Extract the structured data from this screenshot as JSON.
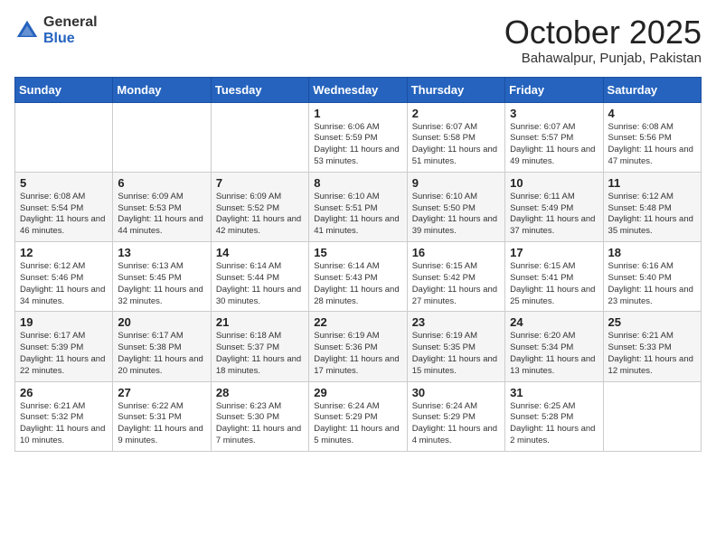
{
  "logo": {
    "general": "General",
    "blue": "Blue"
  },
  "title": "October 2025",
  "location": "Bahawalpur, Punjab, Pakistan",
  "days_of_week": [
    "Sunday",
    "Monday",
    "Tuesday",
    "Wednesday",
    "Thursday",
    "Friday",
    "Saturday"
  ],
  "weeks": [
    [
      {
        "day": "",
        "info": ""
      },
      {
        "day": "",
        "info": ""
      },
      {
        "day": "",
        "info": ""
      },
      {
        "day": "1",
        "info": "Sunrise: 6:06 AM\nSunset: 5:59 PM\nDaylight: 11 hours and 53 minutes."
      },
      {
        "day": "2",
        "info": "Sunrise: 6:07 AM\nSunset: 5:58 PM\nDaylight: 11 hours and 51 minutes."
      },
      {
        "day": "3",
        "info": "Sunrise: 6:07 AM\nSunset: 5:57 PM\nDaylight: 11 hours and 49 minutes."
      },
      {
        "day": "4",
        "info": "Sunrise: 6:08 AM\nSunset: 5:56 PM\nDaylight: 11 hours and 47 minutes."
      }
    ],
    [
      {
        "day": "5",
        "info": "Sunrise: 6:08 AM\nSunset: 5:54 PM\nDaylight: 11 hours and 46 minutes."
      },
      {
        "day": "6",
        "info": "Sunrise: 6:09 AM\nSunset: 5:53 PM\nDaylight: 11 hours and 44 minutes."
      },
      {
        "day": "7",
        "info": "Sunrise: 6:09 AM\nSunset: 5:52 PM\nDaylight: 11 hours and 42 minutes."
      },
      {
        "day": "8",
        "info": "Sunrise: 6:10 AM\nSunset: 5:51 PM\nDaylight: 11 hours and 41 minutes."
      },
      {
        "day": "9",
        "info": "Sunrise: 6:10 AM\nSunset: 5:50 PM\nDaylight: 11 hours and 39 minutes."
      },
      {
        "day": "10",
        "info": "Sunrise: 6:11 AM\nSunset: 5:49 PM\nDaylight: 11 hours and 37 minutes."
      },
      {
        "day": "11",
        "info": "Sunrise: 6:12 AM\nSunset: 5:48 PM\nDaylight: 11 hours and 35 minutes."
      }
    ],
    [
      {
        "day": "12",
        "info": "Sunrise: 6:12 AM\nSunset: 5:46 PM\nDaylight: 11 hours and 34 minutes."
      },
      {
        "day": "13",
        "info": "Sunrise: 6:13 AM\nSunset: 5:45 PM\nDaylight: 11 hours and 32 minutes."
      },
      {
        "day": "14",
        "info": "Sunrise: 6:14 AM\nSunset: 5:44 PM\nDaylight: 11 hours and 30 minutes."
      },
      {
        "day": "15",
        "info": "Sunrise: 6:14 AM\nSunset: 5:43 PM\nDaylight: 11 hours and 28 minutes."
      },
      {
        "day": "16",
        "info": "Sunrise: 6:15 AM\nSunset: 5:42 PM\nDaylight: 11 hours and 27 minutes."
      },
      {
        "day": "17",
        "info": "Sunrise: 6:15 AM\nSunset: 5:41 PM\nDaylight: 11 hours and 25 minutes."
      },
      {
        "day": "18",
        "info": "Sunrise: 6:16 AM\nSunset: 5:40 PM\nDaylight: 11 hours and 23 minutes."
      }
    ],
    [
      {
        "day": "19",
        "info": "Sunrise: 6:17 AM\nSunset: 5:39 PM\nDaylight: 11 hours and 22 minutes."
      },
      {
        "day": "20",
        "info": "Sunrise: 6:17 AM\nSunset: 5:38 PM\nDaylight: 11 hours and 20 minutes."
      },
      {
        "day": "21",
        "info": "Sunrise: 6:18 AM\nSunset: 5:37 PM\nDaylight: 11 hours and 18 minutes."
      },
      {
        "day": "22",
        "info": "Sunrise: 6:19 AM\nSunset: 5:36 PM\nDaylight: 11 hours and 17 minutes."
      },
      {
        "day": "23",
        "info": "Sunrise: 6:19 AM\nSunset: 5:35 PM\nDaylight: 11 hours and 15 minutes."
      },
      {
        "day": "24",
        "info": "Sunrise: 6:20 AM\nSunset: 5:34 PM\nDaylight: 11 hours and 13 minutes."
      },
      {
        "day": "25",
        "info": "Sunrise: 6:21 AM\nSunset: 5:33 PM\nDaylight: 11 hours and 12 minutes."
      }
    ],
    [
      {
        "day": "26",
        "info": "Sunrise: 6:21 AM\nSunset: 5:32 PM\nDaylight: 11 hours and 10 minutes."
      },
      {
        "day": "27",
        "info": "Sunrise: 6:22 AM\nSunset: 5:31 PM\nDaylight: 11 hours and 9 minutes."
      },
      {
        "day": "28",
        "info": "Sunrise: 6:23 AM\nSunset: 5:30 PM\nDaylight: 11 hours and 7 minutes."
      },
      {
        "day": "29",
        "info": "Sunrise: 6:24 AM\nSunset: 5:29 PM\nDaylight: 11 hours and 5 minutes."
      },
      {
        "day": "30",
        "info": "Sunrise: 6:24 AM\nSunset: 5:29 PM\nDaylight: 11 hours and 4 minutes."
      },
      {
        "day": "31",
        "info": "Sunrise: 6:25 AM\nSunset: 5:28 PM\nDaylight: 11 hours and 2 minutes."
      },
      {
        "day": "",
        "info": ""
      }
    ]
  ]
}
